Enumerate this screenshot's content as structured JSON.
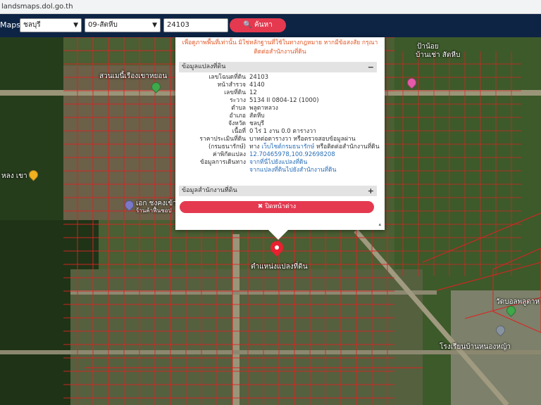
{
  "browser": {
    "url": "landsmaps.dol.go.th"
  },
  "toolbar": {
    "brand": "Maps",
    "province": "ชลบุรี",
    "amphoe": "09-สัตหีบ",
    "parcel_input": "24103",
    "search_label": "ค้นหา"
  },
  "popup": {
    "notice_line1": "เพื่อดูภาพพื้นที่เท่านั้น มิใช่หลักฐานที่ใช้ในทางกฎหมาย หากมีข้อสงสัย กรุณา",
    "notice_line2": "ติดต่อสำนักงานที่ดิน",
    "section1_title": "ข้อมูลแปลงที่ดิน",
    "section1_toggle": "−",
    "rows": [
      {
        "label": "เลขโฉนดที่ดิน",
        "value": "24103"
      },
      {
        "label": "หน้าสำรวจ",
        "value": "4140"
      },
      {
        "label": "เลขที่ดิน",
        "value": "12"
      },
      {
        "label": "ระวาง",
        "value": "5134 II 0804-12 (1000)"
      },
      {
        "label": "ตำบล",
        "value": "พลูตาหลวง"
      },
      {
        "label": "อำเภอ",
        "value": "สัตหีบ"
      },
      {
        "label": "จังหวัด",
        "value": "ชลบุรี"
      },
      {
        "label": "เนื้อที่",
        "value": "0 ไร่ 1 งาน 0.0 ตารางวา"
      },
      {
        "label": "ราคาประเมินที่ดิน",
        "value": "บาทต่อตารางวา หรือตรวจสอบข้อมูลผ่าน"
      },
      {
        "label": "(กรมธนารักษ์)",
        "value_prefix": "ทาง ",
        "value_link": "เว็บไซต์กรมธนารักษ์",
        "value_suffix": " หรือติดต่อสำนักงานที่ดิน"
      },
      {
        "label": "ค่าพิกัดแปลง",
        "value": "12.70465978,100.92698208",
        "link": true
      },
      {
        "label": "ข้อมูลการเดินทาง",
        "value": "จากที่นี่ไปยังแปลงที่ดิน",
        "link": true
      },
      {
        "label": "",
        "value": "จากแปลงที่ดินไปยังสำนักงานที่ดิน",
        "link": true
      }
    ],
    "section2_title": "ข้อมูลสำนักงานที่ดิน",
    "section2_toggle": "+",
    "close_label": "✖ ปิดหน้าต่าง"
  },
  "map_labels": {
    "park": "สวนเมนี้เรืองเขาหยอน",
    "pa_noi": "ป้าน้อย",
    "baan_khao": "บ้านเช่า สัตหีบ",
    "nong_khao": "หลง เขา",
    "ekachai": "เอก ชงคงเข้า",
    "ekachai2": "ร้านค้าฟื้นชอป",
    "parcel_position": "ตำแหน่งแปลงที่ดิน",
    "temple": "วัดบอลพลูตาห",
    "school": "โรงเรียนบ้านหนองหญ้า"
  }
}
